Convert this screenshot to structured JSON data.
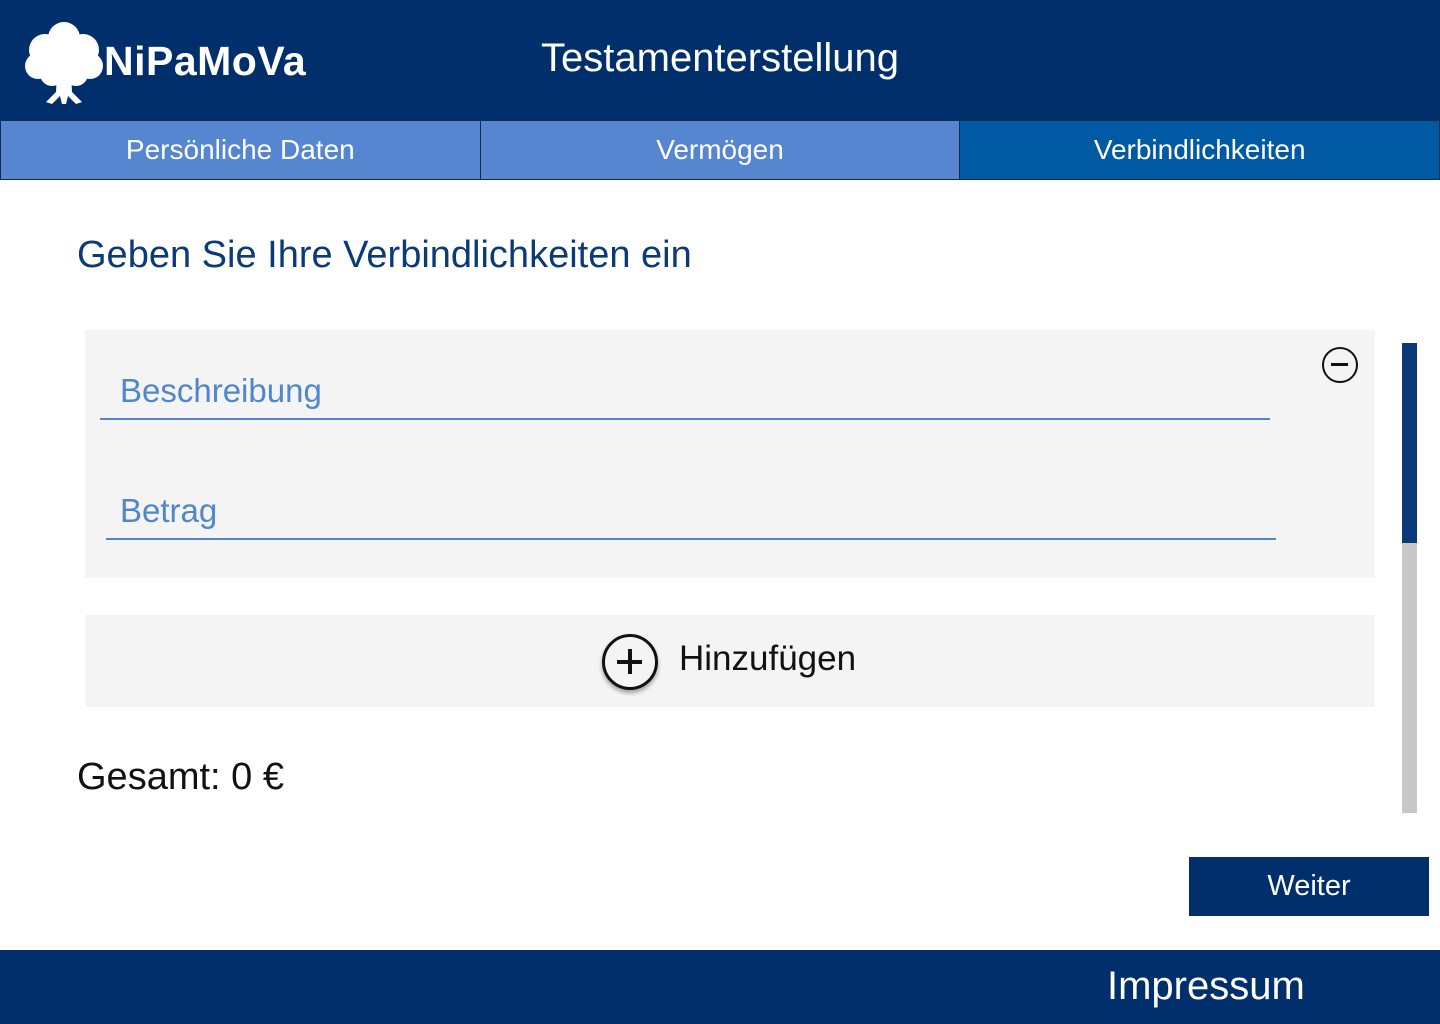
{
  "header": {
    "brand": "NiPaMoVa",
    "logo_icon": "tree-icon",
    "title": "Testamenterstellung"
  },
  "tabs": [
    {
      "label": "Persönliche Daten",
      "active": false
    },
    {
      "label": "Vermögen",
      "active": false
    },
    {
      "label": "Verbindlichkeiten",
      "active": true
    }
  ],
  "main": {
    "heading": "Geben Sie Ihre Verbindlichkeiten ein",
    "entry": {
      "description_placeholder": "Beschreibung",
      "amount_placeholder": "Betrag",
      "remove_icon": "minus-circle-icon"
    },
    "add": {
      "label": "Hinzufügen",
      "icon": "plus-circle-icon"
    },
    "total": {
      "label": "Gesamt:",
      "value": "0 €"
    }
  },
  "actions": {
    "next_label": "Weiter"
  },
  "footer": {
    "impressum": "Impressum"
  },
  "colors": {
    "primary": "#002f6c",
    "tab": "#5586cf",
    "tab_active": "#0059a3",
    "accent": "#4f86cd",
    "card_bg": "#f4f4f4"
  }
}
